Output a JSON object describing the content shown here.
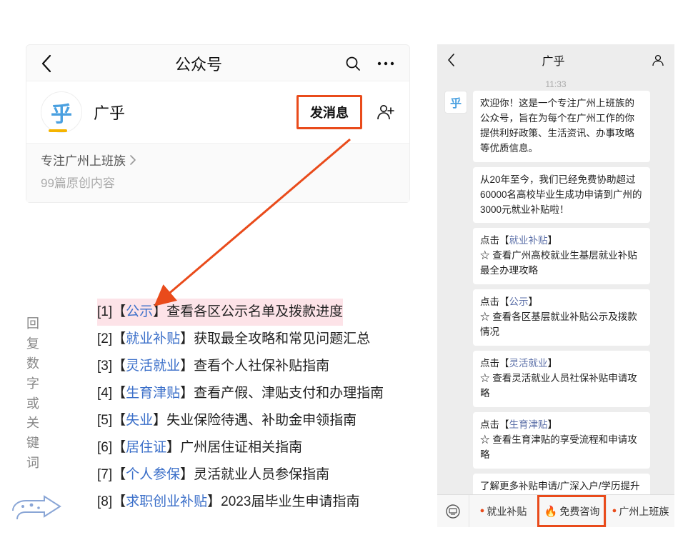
{
  "left": {
    "header_title": "公众号",
    "account_name": "广乎",
    "send_message": "发消息",
    "tagline": "专注广州上班族",
    "articles": "99篇原创内容"
  },
  "reply_label": "回复数字或关键词",
  "reply_items": [
    {
      "index": "[1]",
      "keyword": "公示",
      "text": "查看各区公示名单及拨款进度",
      "highlight": true
    },
    {
      "index": "[2]",
      "keyword": "就业补贴",
      "text": "获取最全攻略和常见问题汇总",
      "highlight": false
    },
    {
      "index": "[3]",
      "keyword": "灵活就业",
      "text": "查看个人社保补贴指南",
      "highlight": false
    },
    {
      "index": "[4]",
      "keyword": "生育津贴",
      "text": "查看产假、津贴支付和办理指南",
      "highlight": false
    },
    {
      "index": "[5]",
      "keyword": "失业",
      "text": "失业保险待遇、补助金申领指南",
      "highlight": false
    },
    {
      "index": "[6]",
      "keyword": "居住证",
      "text": "广州居住证相关指南",
      "highlight": false
    },
    {
      "index": "[7]",
      "keyword": "个人参保",
      "text": "灵活就业人员参保指南",
      "highlight": false
    },
    {
      "index": "[8]",
      "keyword": "求职创业补贴",
      "text": "2023届毕业生申请指南",
      "highlight": false
    }
  ],
  "chat": {
    "title": "广乎",
    "time": "11:33",
    "messages": [
      {
        "avatar": true,
        "segments": [
          {
            "t": "欢迎你！这是一个专注广州上班族的公众号，旨在为每个在广州工作的你提供利好政策、生活资讯、办事攻略等优质信息。"
          }
        ]
      },
      {
        "avatar": false,
        "segments": [
          {
            "t": "从20年至今，我们已经免费协助超过60000名高校毕业生成功申请到广州的3000元就业补贴啦！"
          }
        ]
      },
      {
        "avatar": false,
        "segments": [
          {
            "t": "点击【"
          },
          {
            "t": "就业补贴",
            "link": true
          },
          {
            "t": "】\n☆ 查看广州高校就业生基层就业补贴最全办理攻略"
          }
        ]
      },
      {
        "avatar": false,
        "segments": [
          {
            "t": "点击【"
          },
          {
            "t": "公示",
            "link": true
          },
          {
            "t": "】\n☆ 查看各区基层就业补贴公示及拨款情况"
          }
        ]
      },
      {
        "avatar": false,
        "segments": [
          {
            "t": "点击【"
          },
          {
            "t": "灵活就业",
            "link": true
          },
          {
            "t": "】\n☆ 查看灵活就业人员社保补贴申请攻略"
          }
        ]
      },
      {
        "avatar": false,
        "segments": [
          {
            "t": "点击【"
          },
          {
            "t": "生育津贴",
            "link": true
          },
          {
            "t": "】\n☆ 查看生育津贴的享受流程和申请攻略"
          }
        ]
      },
      {
        "avatar": false,
        "segments": [
          {
            "t": "了解更多补贴申请/广深入户/学历提升等资讯，可直接联系我们咨询♡"
          }
        ]
      }
    ],
    "menu": [
      {
        "label": "就业补贴",
        "dot": true,
        "fire": false,
        "highlight": false
      },
      {
        "label": "免费咨询",
        "dot": false,
        "fire": true,
        "highlight": true
      },
      {
        "label": "广州上班族",
        "dot": true,
        "fire": false,
        "highlight": false
      }
    ]
  }
}
